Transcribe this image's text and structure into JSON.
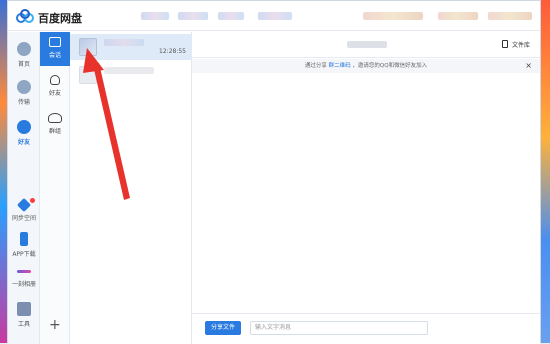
{
  "app": {
    "title": "百度网盘"
  },
  "sidebar": {
    "items": [
      {
        "label": "首页",
        "icon": "cloud-icon"
      },
      {
        "label": "传输",
        "icon": "transfer-icon"
      },
      {
        "label": "好友",
        "icon": "friends-icon",
        "active": true
      },
      {
        "label": "同步空间",
        "icon": "sync-icon",
        "badge": true
      },
      {
        "label": "APP下载",
        "icon": "phone-icon"
      },
      {
        "label": "一刻相册",
        "icon": "album-icon"
      },
      {
        "label": "工具",
        "icon": "tools-icon"
      }
    ]
  },
  "subnav": {
    "items": [
      {
        "label": "会话",
        "active": true
      },
      {
        "label": "好友"
      },
      {
        "label": "群组"
      }
    ]
  },
  "conversations": [
    {
      "time": "12:28:55",
      "selected": true
    },
    {
      "time": ""
    }
  ],
  "chat": {
    "library_label": "文件库",
    "notice_prefix": "通过分享 ",
    "notice_link": "群二维码",
    "notice_suffix": " ，邀请您的QQ和微信好友加入",
    "close": "×",
    "share_button": "分享文件",
    "input_placeholder": "输入文字消息"
  },
  "colors": {
    "accent": "#2a7be0",
    "arrow": "#e8322c"
  }
}
